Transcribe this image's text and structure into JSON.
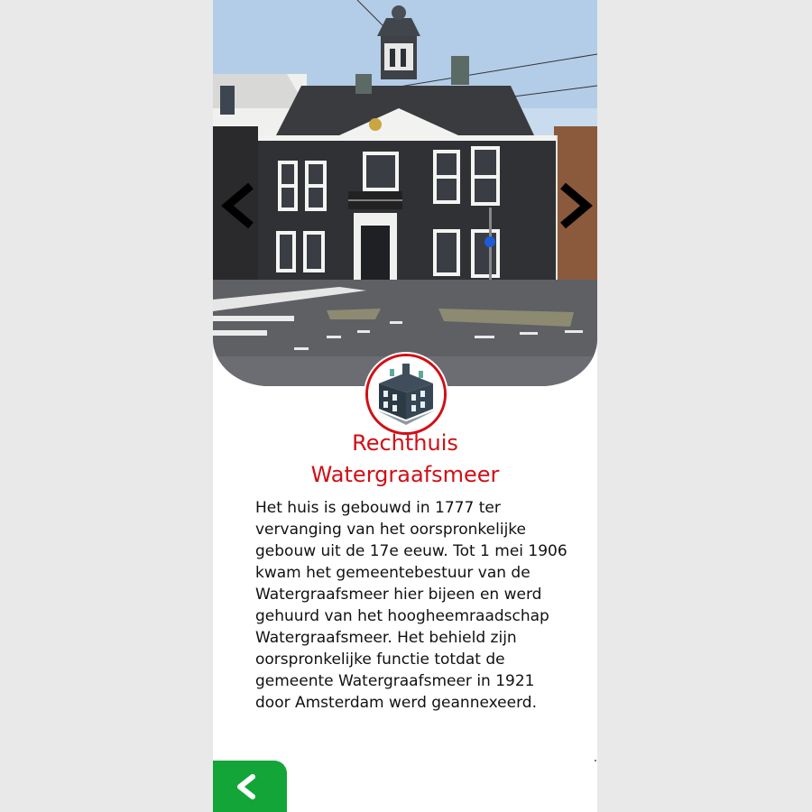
{
  "building": {
    "title_line1": "Rechthuis",
    "title_line2": "Watergraafsmeer",
    "description": "Het huis is gebouwd in 1777 ter vervanging van het oorspronkelijke gebouw uit de 17e eeuw. Tot 1 mei 1906 kwam het gemeentebestuur van de Watergraafsmeer hier bijeen en werd gehuurd van het hoogheemraadschap Watergraafsmeer. Het behield zijn oorspronkelijke functie totdat de gemeente Watergraafsmeer in 1921 door Amsterdam werd geannexeerd."
  },
  "navigation": {
    "prev_icon": "chevron-left-icon",
    "next_icon": "chevron-right-icon",
    "back_icon": "chevron-left-icon"
  },
  "colors": {
    "accent": "#d10f16",
    "back_button": "#13a538",
    "text": "#111111"
  }
}
